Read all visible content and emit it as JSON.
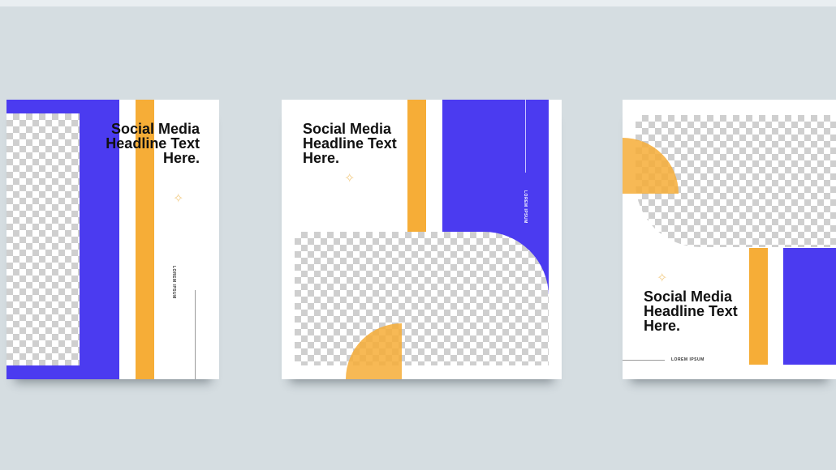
{
  "colors": {
    "background": "#d5dde1",
    "card": "#ffffff",
    "blue": "#4b3bf0",
    "orange": "#f6ad37",
    "star": "#f3cf8c",
    "text": "#111111"
  },
  "templates": [
    {
      "headline": [
        "Social Media",
        "Headline Text",
        "Here."
      ],
      "caption": "LOREM IPSUM",
      "star_icon": "sparkle-icon"
    },
    {
      "headline": [
        "Social Media",
        "Headline Text",
        "Here."
      ],
      "caption": "LOREM IPSUM",
      "star_icon": "sparkle-icon"
    },
    {
      "headline": [
        "Social Media",
        "Headline Text",
        "Here."
      ],
      "caption": "LOREM IPSUM",
      "star_icon": "sparkle-icon"
    }
  ]
}
